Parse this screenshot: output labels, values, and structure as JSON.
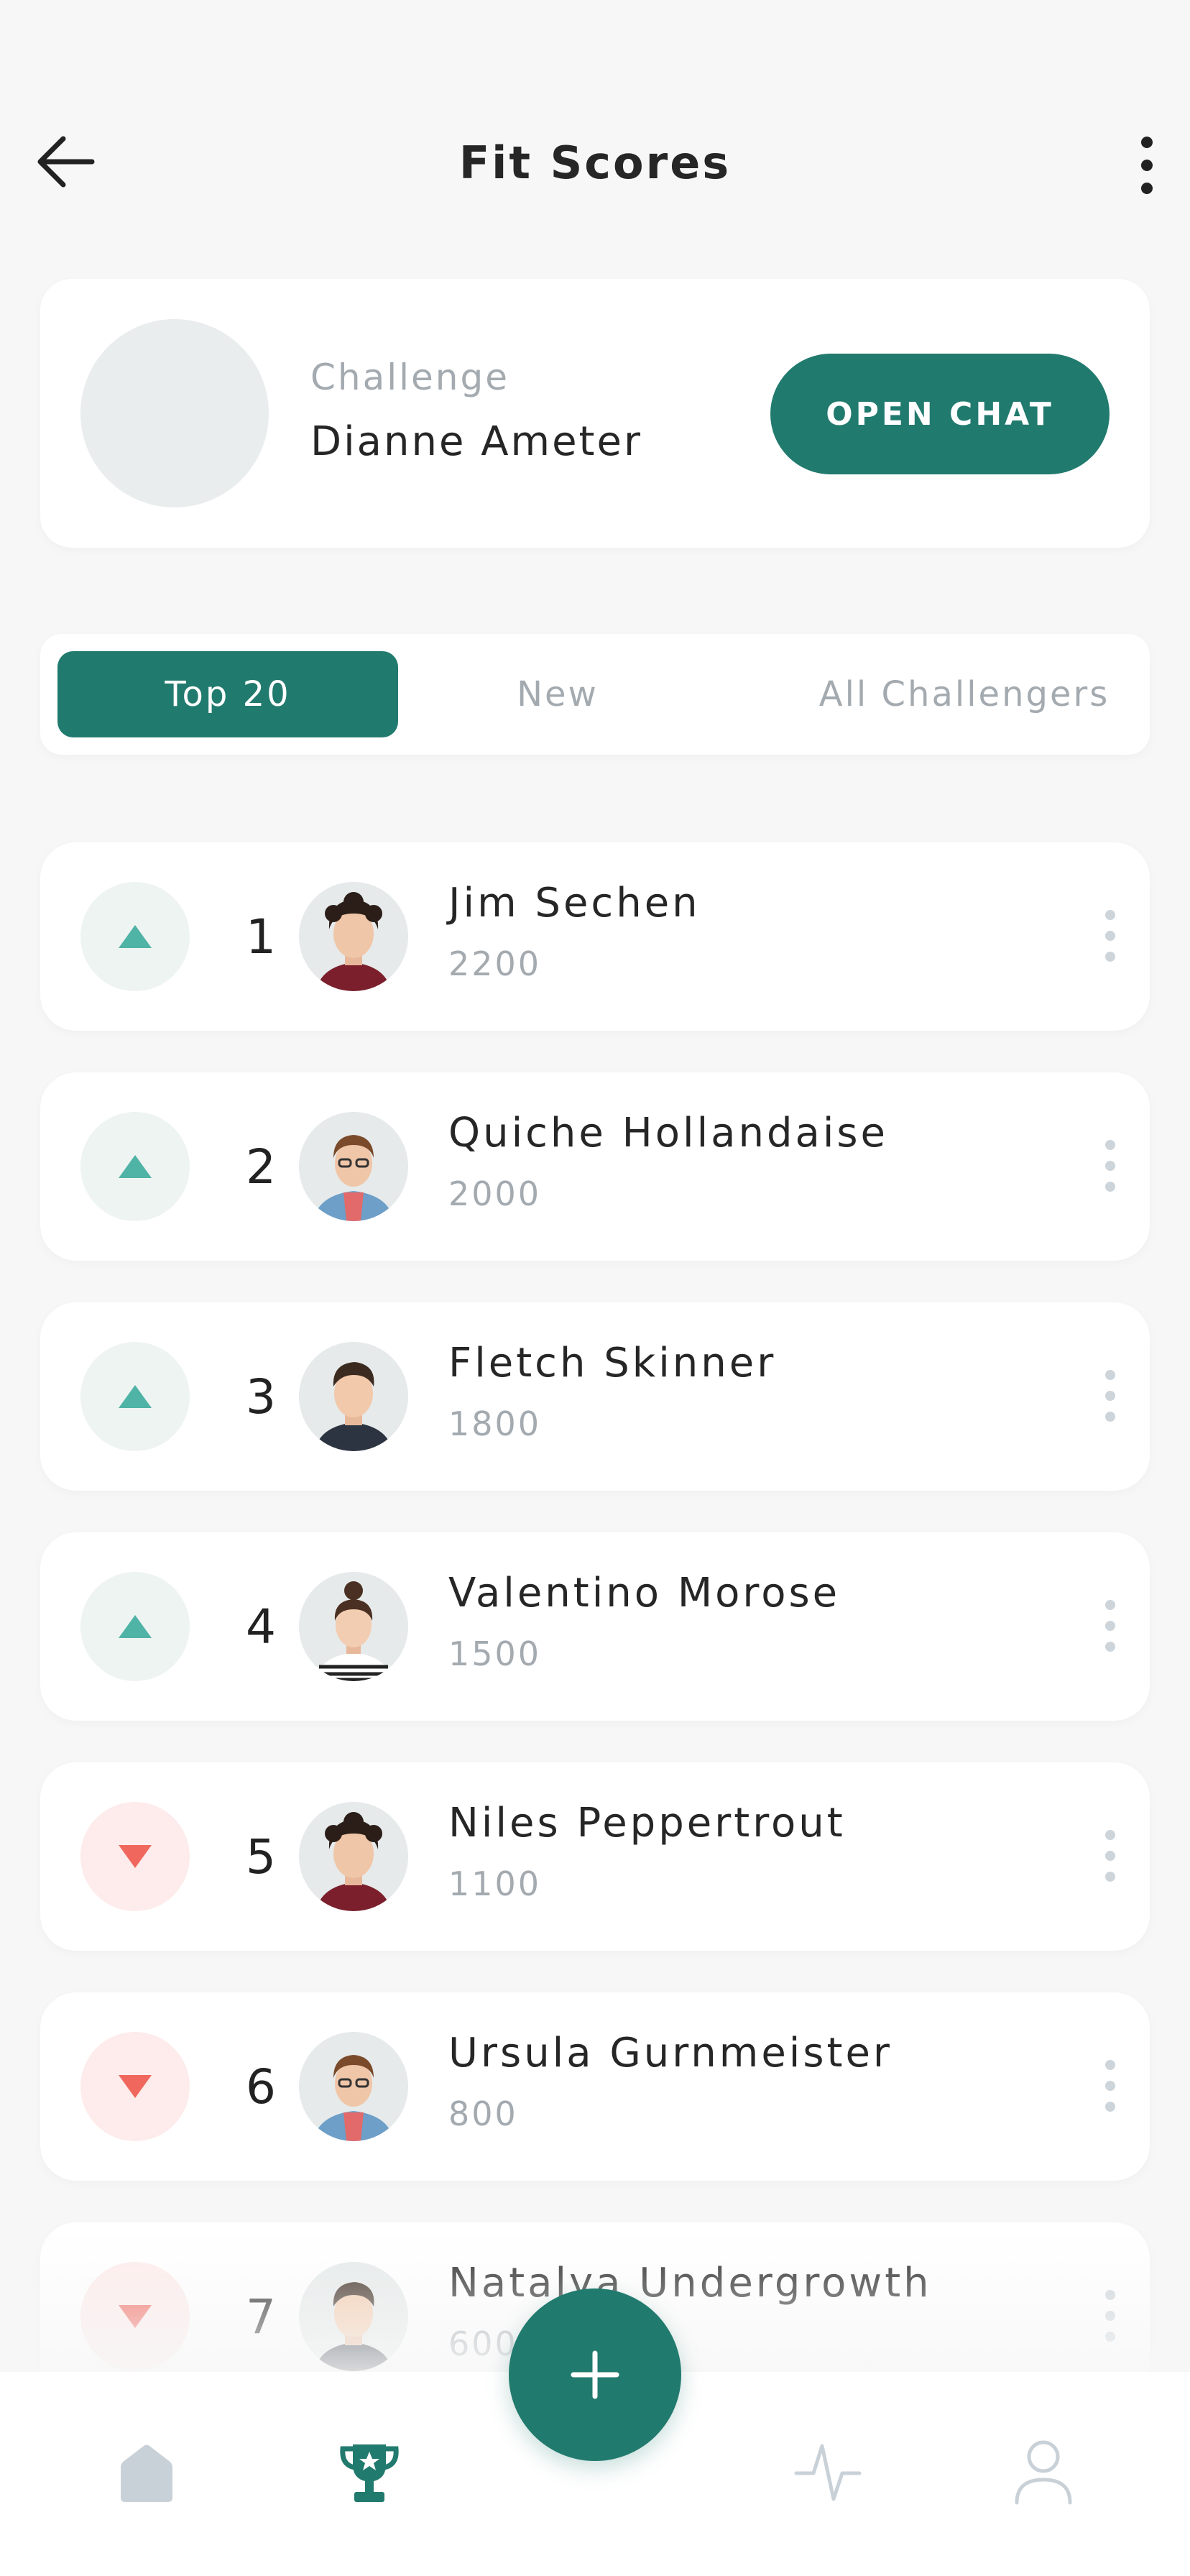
{
  "header": {
    "title": "Fit Scores"
  },
  "challenge": {
    "label": "Challenge",
    "name": "Dianne Ameter",
    "button_label": "OPEN CHAT"
  },
  "tabs": [
    {
      "label": "Top 20",
      "active": true
    },
    {
      "label": "New",
      "active": false
    },
    {
      "label": "All Challengers",
      "active": false
    }
  ],
  "leaderboard": [
    {
      "rank": "1",
      "name": "Jim Sechen",
      "score": "2200",
      "trend": "up"
    },
    {
      "rank": "2",
      "name": "Quiche Hollandaise",
      "score": "2000",
      "trend": "up"
    },
    {
      "rank": "3",
      "name": "Fletch Skinner",
      "score": "1800",
      "trend": "up"
    },
    {
      "rank": "4",
      "name": "Valentino Morose",
      "score": "1500",
      "trend": "up"
    },
    {
      "rank": "5",
      "name": "Niles Peppertrout",
      "score": "1100",
      "trend": "down"
    },
    {
      "rank": "6",
      "name": "Ursula Gurnmeister",
      "score": "800",
      "trend": "down"
    },
    {
      "rank": "7",
      "name": "Natalya Undergrowth",
      "score": "600",
      "trend": "down"
    }
  ],
  "bottom_nav": [
    {
      "icon": "home-icon",
      "active": false
    },
    {
      "icon": "trophy-icon",
      "active": true
    },
    {
      "icon": "activity-icon",
      "active": false
    },
    {
      "icon": "profile-icon",
      "active": false
    }
  ],
  "colors": {
    "primary": "#217a6e",
    "trend_up": "#4fb3a6",
    "trend_down": "#f0675e",
    "muted_text": "#a3aab0",
    "nav_inactive": "#c9d1d8"
  }
}
